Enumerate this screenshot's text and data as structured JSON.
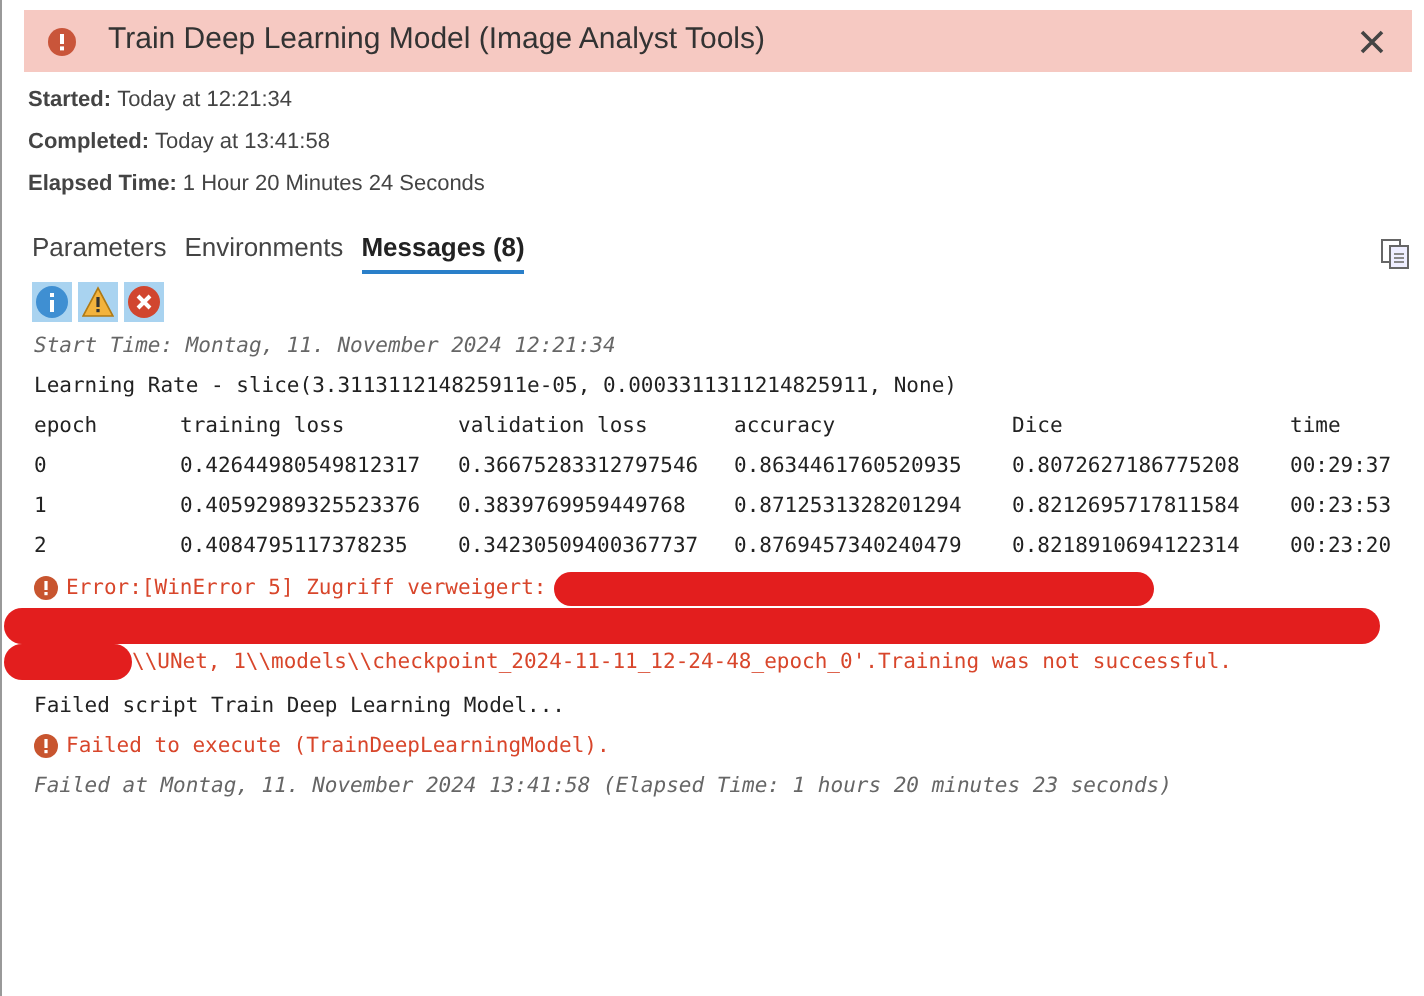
{
  "header": {
    "title": "Train Deep Learning Model (Image Analyst Tools)"
  },
  "details": [
    {
      "label": "Started:",
      "value": "Today at 12:21:34"
    },
    {
      "label": "Completed:",
      "value": "Today at 13:41:58"
    },
    {
      "label": "Elapsed Time:",
      "value": "1 Hour 20 Minutes 24 Seconds"
    }
  ],
  "tabs": [
    {
      "label": "Parameters",
      "selected": false
    },
    {
      "label": "Environments",
      "selected": false
    },
    {
      "label": "Messages (8)",
      "selected": true
    }
  ],
  "filters": [
    {
      "kind": "info",
      "selected": true
    },
    {
      "kind": "warning",
      "selected": true
    },
    {
      "kind": "error",
      "selected": true
    }
  ],
  "messages": [
    {
      "kind": "time",
      "text": "Start Time: Montag, 11. November 2024 12:21:34"
    },
    {
      "kind": "plain",
      "text": "Learning Rate - slice(3.311311214825911e-05, 0.0003311311214825911, None)"
    },
    {
      "kind": "table",
      "columns": [
        "epoch",
        "training loss",
        "validation loss",
        "accuracy",
        "Dice",
        "time"
      ],
      "rows": [
        [
          "0",
          "0.42644980549812317",
          "0.36675283312797546",
          "0.8634461760520935",
          "0.8072627186775208",
          "00:29:37"
        ],
        [
          "1",
          "0.40592989325523376",
          "0.3839769959449768",
          "0.8712531328201294",
          "0.8212695717811584",
          "00:23:53"
        ],
        [
          "2",
          "0.4084795117378235",
          "0.34230509400367737",
          "0.8769457340240479",
          "0.8218910694122314",
          "00:23:20"
        ]
      ]
    },
    {
      "kind": "error",
      "text": "Error:[WinError 5] Zugriff verweigert:",
      "redacted": true,
      "continuation": "\\\\UNet, 1\\\\models\\\\checkpoint_2024-11-11_12-24-48_epoch_0'.Training was not successful."
    },
    {
      "kind": "plain",
      "text": "Failed script Train Deep Learning Model..."
    },
    {
      "kind": "error",
      "text": "Failed to execute (TrainDeepLearningModel)."
    },
    {
      "kind": "time",
      "text": "Failed at Montag, 11. November 2024 13:41:58 (Elapsed Time: 1 hours 20 minutes 23 seconds)"
    }
  ]
}
